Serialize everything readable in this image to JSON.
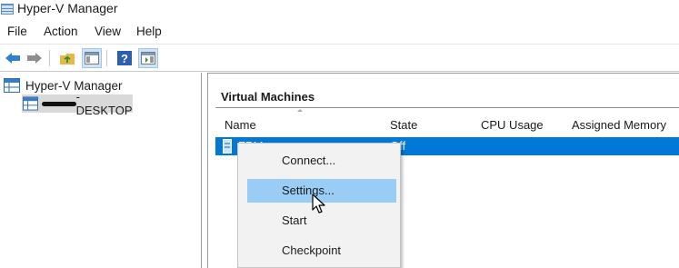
{
  "window": {
    "title": "Hyper-V Manager"
  },
  "menu": [
    "File",
    "Action",
    "View",
    "Help"
  ],
  "toolbar": {
    "buttons": [
      "back-arrow-icon",
      "forward-arrow-icon",
      "up-folder-icon",
      "show-hide-console-tree-icon",
      "help-icon",
      "show-hide-action-pane-icon"
    ],
    "pressed": [
      "show-hide-console-tree-icon",
      "show-hide-action-pane-icon"
    ]
  },
  "tree": {
    "root": "Hyper-V Manager",
    "server_suffix": "-DESKTOP"
  },
  "content": {
    "section_title": "Virtual Machines",
    "columns": [
      "Name",
      "State",
      "CPU Usage",
      "Assigned Memory"
    ],
    "rows": [
      {
        "name": "FPM",
        "state": "Off",
        "cpu": "",
        "memory": ""
      }
    ],
    "selected_row_color": "#0078d7"
  },
  "context_menu": {
    "items": [
      "Connect...",
      "Settings...",
      "Start",
      "Checkpoint"
    ],
    "hovered": "Settings...",
    "hover_color": "#99cdf5"
  }
}
